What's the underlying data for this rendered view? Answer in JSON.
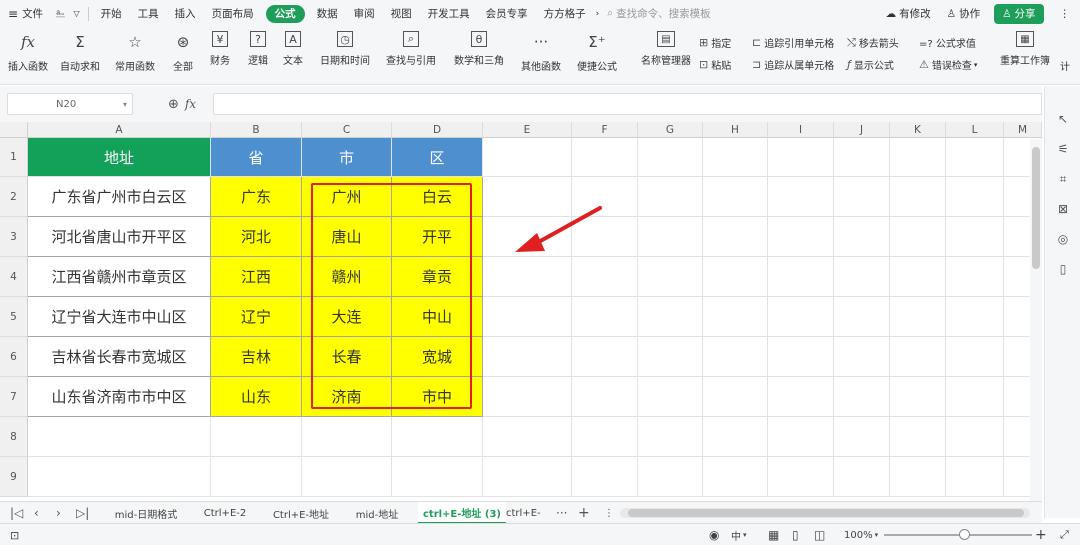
{
  "titlebar": {
    "menu_label": "文件",
    "tabs": [
      "开始",
      "工具",
      "插入",
      "页面布局",
      "公式",
      "数据",
      "审阅",
      "视图",
      "开发工具",
      "会员专享",
      "方方格子"
    ],
    "active_tab": "公式",
    "search_placeholder": "查找命令、搜索模板",
    "modified_label": "有修改",
    "collab_label": "协作",
    "share_label": "分享"
  },
  "ribbon": {
    "buttons": [
      {
        "label": "插入函数",
        "icon": "fx-icon"
      },
      {
        "label": "自动求和",
        "icon": "sigma-icon"
      },
      {
        "label": "常用函数",
        "icon": "star-icon"
      },
      {
        "label": "全部",
        "icon": "asterisk-circle-icon"
      },
      {
        "label": "财务",
        "icon": "yen-icon"
      },
      {
        "label": "逻辑",
        "icon": "question-icon"
      },
      {
        "label": "文本",
        "icon": "text-icon"
      },
      {
        "label": "日期和时间",
        "icon": "clock-icon"
      },
      {
        "label": "查找与引用",
        "icon": "magnifier-icon"
      },
      {
        "label": "数学和三角",
        "icon": "theta-icon"
      },
      {
        "label": "其他函数",
        "icon": "dots-icon"
      },
      {
        "label": "便捷公式",
        "icon": "sigma-plus-icon"
      },
      {
        "label": "名称管理器",
        "icon": "name-manager-icon"
      }
    ],
    "small": {
      "define": "指定",
      "paste": "粘贴",
      "trace_precedents": "追踪引用单元格",
      "trace_dependents": "追踪从属单元格",
      "remove_arrows": "移去箭头",
      "show_formulas": "显示公式",
      "evaluate": "=? 公式求值",
      "error_check": "错误检查",
      "recalc": "重算工作簿",
      "calc_partial": "计"
    }
  },
  "formulabar": {
    "name_box": "N20",
    "fx": "fx",
    "value": ""
  },
  "grid": {
    "columns": [
      "A",
      "B",
      "C",
      "D",
      "E",
      "F",
      "G",
      "H",
      "I",
      "J",
      "K",
      "L",
      "M"
    ],
    "rows": [
      "1",
      "2",
      "3",
      "4",
      "5",
      "6",
      "7",
      "8",
      "9"
    ],
    "headers": [
      "地址",
      "省",
      "市",
      "区"
    ],
    "data": [
      [
        "广东省广州市白云区",
        "广东",
        "广州",
        "白云"
      ],
      [
        "河北省唐山市开平区",
        "河北",
        "唐山",
        "开平"
      ],
      [
        "江西省赣州市章贡区",
        "江西",
        "赣州",
        "章贡"
      ],
      [
        "辽宁省大连市中山区",
        "辽宁",
        "大连",
        "中山"
      ],
      [
        "吉林省长春市宽城区",
        "吉林",
        "长春",
        "宽城"
      ],
      [
        "山东省济南市市中区",
        "山东",
        "济南",
        "市中"
      ]
    ],
    "colors": {
      "header_a": "#13a15a",
      "header_bcd": "#4e8fcf",
      "fill": "#ffff00",
      "highlight": "#e02020"
    }
  },
  "sheets": [
    "mid-日期格式",
    "Ctrl+E-2",
    "Ctrl+E-地址",
    "mid-地址",
    "ctrl+E-地址 (3)",
    "ctrl+E-"
  ],
  "active_sheet": "ctrl+E-地址 (3)",
  "sheet_more": "···",
  "sheet_add": "+",
  "status": {
    "input_mode": "中",
    "zoom": "100%",
    "minus": "−",
    "plus": "+"
  }
}
